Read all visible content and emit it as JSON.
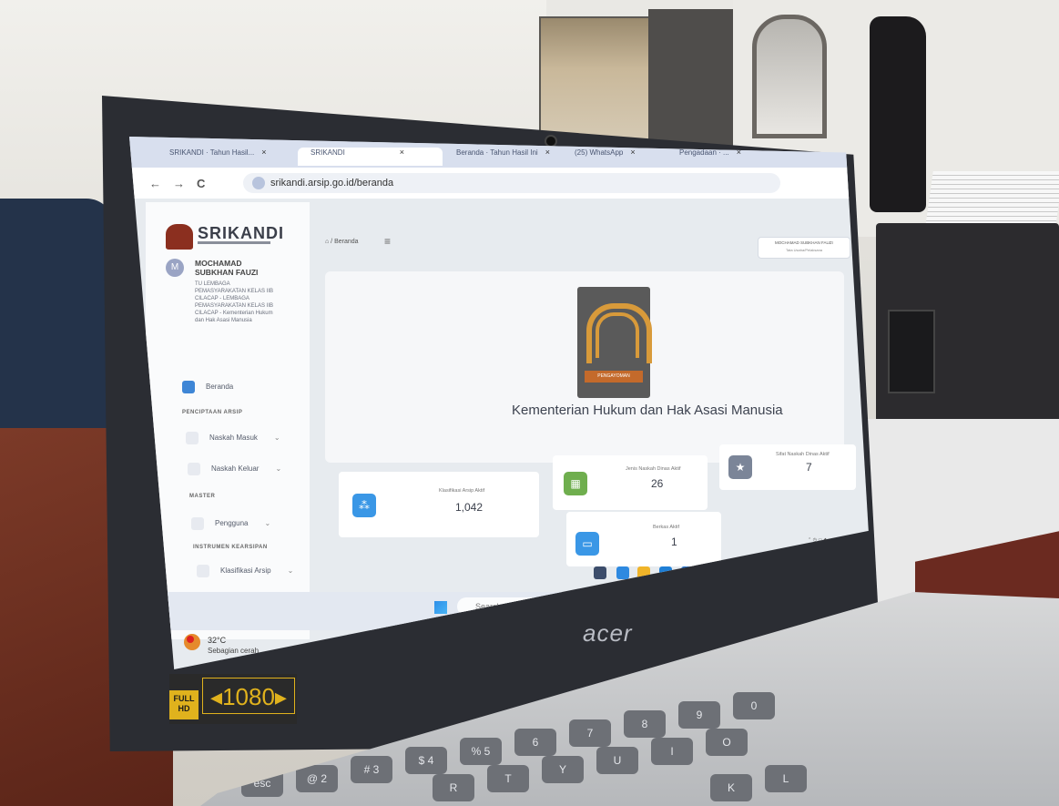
{
  "browser": {
    "tabs": [
      {
        "label": "SRIKANDI · Tahun Hasil...",
        "active": false
      },
      {
        "label": "SRIKANDI",
        "active": true
      },
      {
        "label": "Beranda · Tahun Hasil Ini",
        "active": false
      },
      {
        "label": "(25) WhatsApp",
        "active": false
      },
      {
        "label": "Pengadaan · ...",
        "active": false
      }
    ],
    "close_glyph": "×",
    "url": "srikandi.arsip.go.id/beranda",
    "back_icon": "←",
    "forward_icon": "→",
    "reload_icon": "C"
  },
  "sidebar": {
    "logo_text": "SRIKANDI",
    "avatar_initial": "M",
    "user_name": "MOCHAMAD SUBKHAN FAUZI",
    "user_info": "TU LEMBAGA PEMASYARAKATAN KELAS IIB CILACAP - LEMBAGA PEMASYARAKATAN KELAS IIB CILACAP - Kementerian Hukum dan Hak Asasi Manusia",
    "items": {
      "beranda": "Beranda",
      "section_penciptaan": "PENCIPTAAN ARSIP",
      "naskah_masuk": "Naskah Masuk",
      "naskah_keluar": "Naskah Keluar",
      "section_master": "MASTER",
      "pengguna": "Pengguna",
      "section_instrumen": "INSTRUMEN KEARSIPAN",
      "klasifikasi": "Klasifikasi Arsip"
    },
    "chevron": "⌄"
  },
  "main": {
    "breadcrumb": "⌂ / Beranda",
    "menu_glyph": "≡",
    "user_chip_name": "MOCHAMAD SUBKHAN FAUZI",
    "user_chip_role": "Tata Usaha/Pelaksana",
    "hero_badge": "PENGAYOMAN",
    "hero_title": "Kementerian Hukum dan Hak Asasi Manusia",
    "stats": {
      "klasifikasi": {
        "label": "Klasifikasi Arsip Aktif",
        "value": "1,042"
      },
      "jenis": {
        "label": "Jenis Naskah Dinas Aktif",
        "value": "26"
      },
      "sifat": {
        "label": "Sifat Naskah Dinas Aktif",
        "value": "7"
      },
      "berkas": {
        "label": "Berkas Aktif",
        "value": "1"
      }
    }
  },
  "taskbar": {
    "search_placeholder": "Search",
    "weather_temp": "32°C",
    "weather_desc": "Sebagian cerah"
  },
  "laptop": {
    "brand": "acer",
    "badge_top": "FULL",
    "badge_bottom": "HD",
    "resolution": "◂1080▸"
  },
  "keyboard": {
    "keys": [
      "esc",
      "@ 2",
      "# 3",
      "$ 4",
      "% 5",
      "6",
      "7",
      "8",
      "9",
      "0",
      "R",
      "T",
      "Y",
      "U",
      "I",
      "O",
      "K",
      "L"
    ]
  }
}
